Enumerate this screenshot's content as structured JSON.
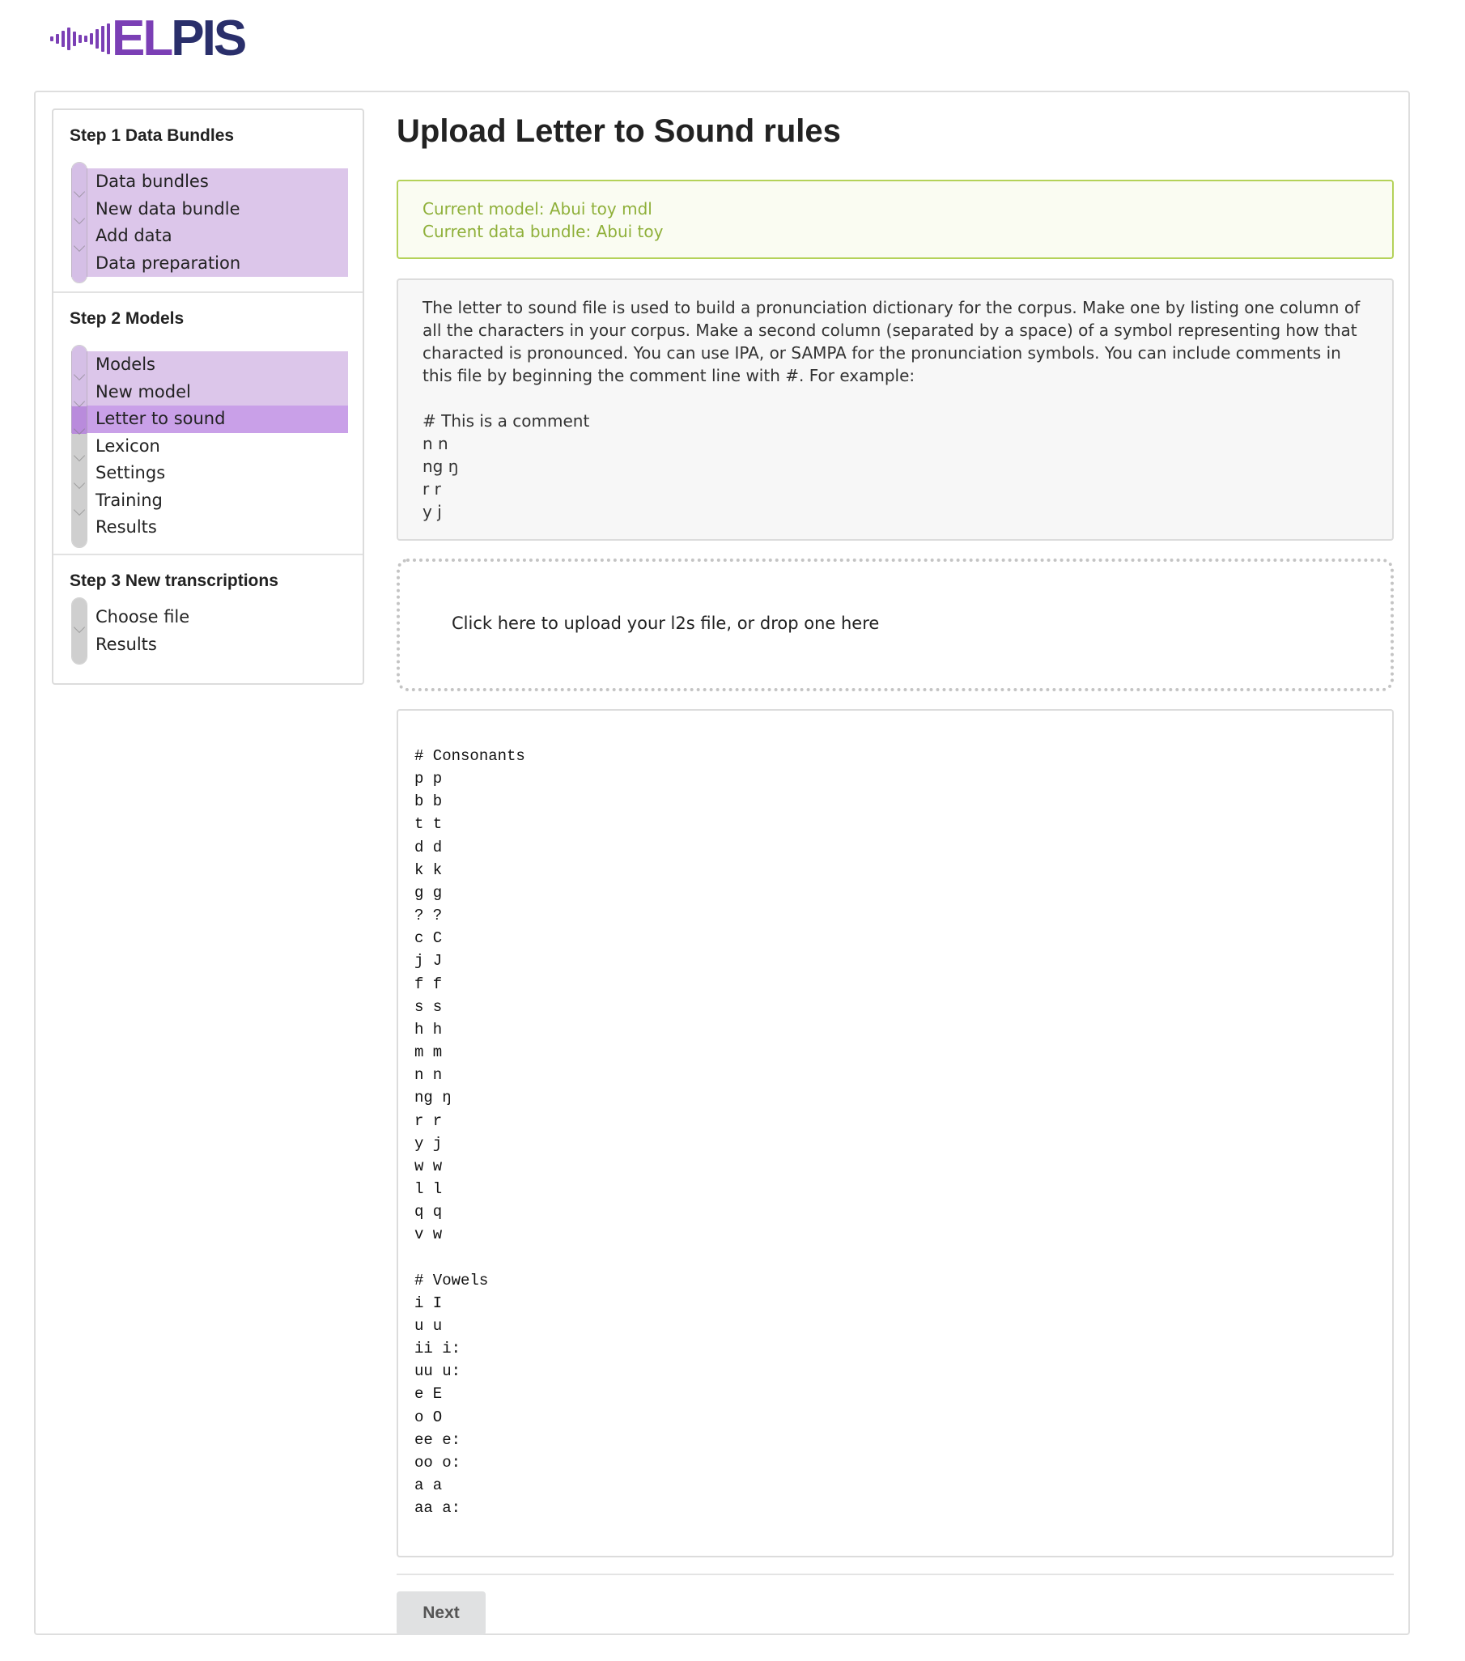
{
  "logo": {
    "text_a": "EL",
    "text_b": "PIS",
    "bar_color": "#7b3fb5",
    "text_color": "#2a2f6b"
  },
  "steps": [
    {
      "title": "Step 1 Data Bundles",
      "items": [
        {
          "label": "Data bundles",
          "state": "done"
        },
        {
          "label": "New data bundle",
          "state": "done"
        },
        {
          "label": "Add data",
          "state": "done"
        },
        {
          "label": "Data preparation",
          "state": "done"
        }
      ]
    },
    {
      "title": "Step 2 Models",
      "items": [
        {
          "label": "Models",
          "state": "done"
        },
        {
          "label": "New model",
          "state": "done"
        },
        {
          "label": "Letter to sound",
          "state": "active"
        },
        {
          "label": "Lexicon",
          "state": "todo"
        },
        {
          "label": "Settings",
          "state": "todo"
        },
        {
          "label": "Training",
          "state": "todo"
        },
        {
          "label": "Results",
          "state": "todo"
        }
      ]
    },
    {
      "title": "Step 3 New transcriptions",
      "items": [
        {
          "label": "Choose file",
          "state": "todo"
        },
        {
          "label": "Results",
          "state": "todo"
        }
      ]
    }
  ],
  "colors": {
    "done": "#dcc6ea",
    "active": "#c9a0e8",
    "rail_done": "#d5bfe6",
    "rail_todo": "#cfcfcf",
    "success_border": "#b4d25a",
    "success_text": "#8fb03a"
  },
  "main": {
    "title": "Upload Letter to Sound rules",
    "current_model": "Current model: Abui toy mdl",
    "current_bundle": "Current data bundle: Abui toy",
    "description": "The letter to sound file is used to build a pronunciation dictionary for the corpus. Make one by listing one column of all the characters in your corpus. Make a second column (separated by a space) of a symbol representing how that characted is pronounced. You can use IPA, or SAMPA for the pronunciation symbols. You can include comments in this file by beginning the comment line with #. For example:",
    "example_lines": [
      "# This is a comment",
      "n n",
      "ng ŋ",
      "r r",
      "y j"
    ],
    "dropzone_text": "Click here to upload your l2s file, or drop one here",
    "file_content": "# Consonants\np p\nb b\nt t\nd d\nk k\ng g\n? ?\nc C\nj J\nf f\ns s\nh h\nm m\nn n\nng ŋ\nr r\ny j\nw w\nl l\nq q\nv w\n\n# Vowels\ni I\nu u\nii i:\nuu u:\ne E\no O\nee e:\noo o:\na a\naa a:",
    "next_label": "Next"
  }
}
